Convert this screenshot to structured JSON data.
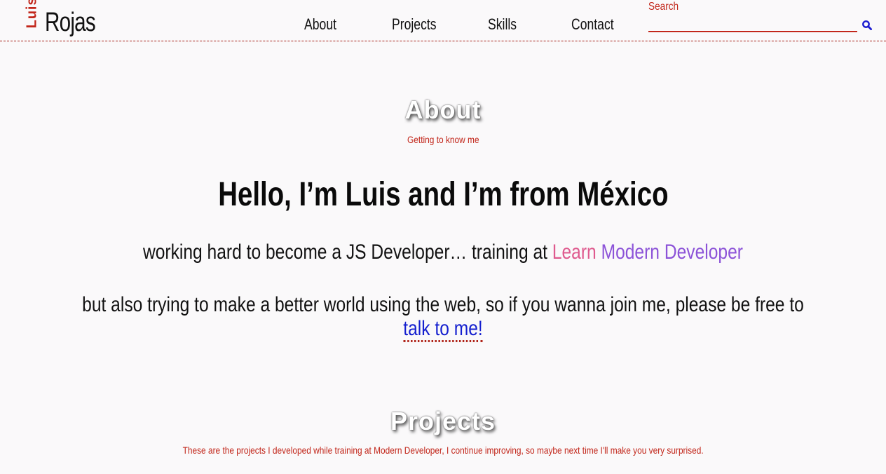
{
  "header": {
    "logo_first": "Luis",
    "logo_last": "Rojas",
    "nav": [
      "About",
      "Projects",
      "Skills",
      "Contact"
    ],
    "search": {
      "label": "Search",
      "value": "",
      "icon": "search-icon"
    }
  },
  "about": {
    "title": "About",
    "subtitle": "Getting to know me",
    "hello": "Hello, I’m Luis and I’m from México",
    "line1_prefix": "working hard to become a JS Developer… training at ",
    "line1_learn": "Learn",
    "line1_modern": "Modern Developer",
    "line2_prefix": "but also trying to make a better world using the web, so if you wanna join me, please be free to ",
    "line2_link": "talk to me!"
  },
  "projects": {
    "title": "Projects",
    "subtitle": "These are the projects I developed while training at Modern Developer, I continue improving, so maybe next time I'll make you very surprised."
  },
  "colors": {
    "accent": "#c2271b",
    "learn": "#df5a8e",
    "modern": "#8c53d8",
    "link": "#1520cf",
    "background": "#faf9fa"
  }
}
